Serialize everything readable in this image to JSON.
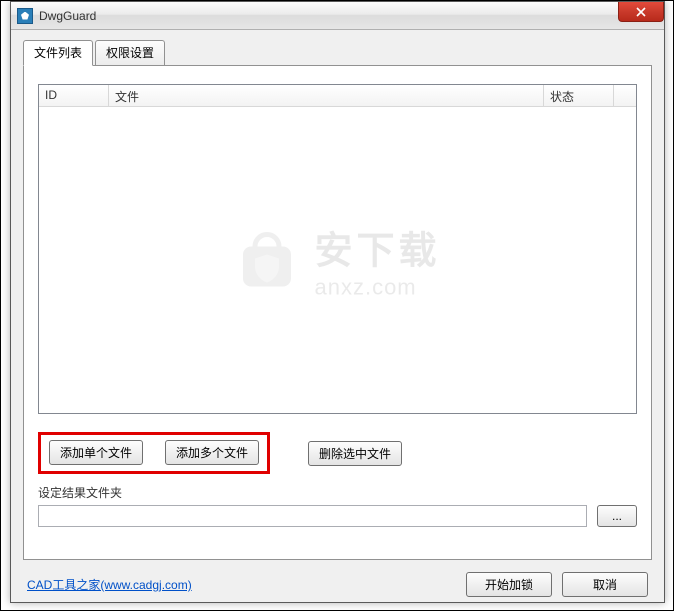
{
  "window": {
    "title": "DwgGuard",
    "close_icon": "close-icon"
  },
  "tabs": {
    "items": [
      {
        "label": "文件列表",
        "active": true
      },
      {
        "label": "权限设置",
        "active": false
      }
    ]
  },
  "listview": {
    "columns": {
      "id": "ID",
      "file": "文件",
      "state": "状态"
    },
    "rows": []
  },
  "buttons": {
    "add_single": "添加单个文件",
    "add_multiple": "添加多个文件",
    "delete_selected": "删除选中文件",
    "browse": "...",
    "start_lock": "开始加锁",
    "cancel": "取消"
  },
  "labels": {
    "output_folder": "设定结果文件夹"
  },
  "inputs": {
    "output_path": ""
  },
  "footer": {
    "link_text": "CAD工具之家(www.cadgj.com)"
  },
  "watermark": {
    "cn": "安下载",
    "en": "anxz.com"
  }
}
